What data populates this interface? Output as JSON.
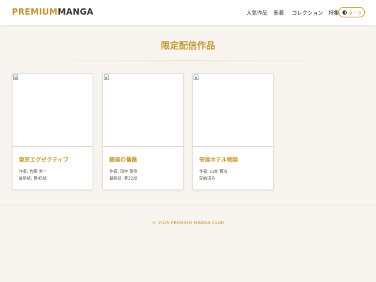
{
  "header": {
    "logo_part1": "PREMIUM",
    "logo_part2": "MANGA",
    "nav": [
      "人気作品",
      "新着",
      "コレクション",
      "特集"
    ],
    "theme_toggle_label": "ダーク"
  },
  "main": {
    "section_title": "限定配信作品",
    "works": [
      {
        "title": "東京エグゼクティブ",
        "author": "作者: 佐藤 栄一",
        "status": "最新話: 第45話"
      },
      {
        "title": "銀座の薔薇",
        "author": "作者: 田中 美咲",
        "status": "最新話: 第22話"
      },
      {
        "title": "帝国ホテル物語",
        "author": "作者: 山本 賢治",
        "status": "完結済み"
      }
    ]
  },
  "footer": {
    "copyright": "© 2025 PREMIUM MANGA CLUB"
  },
  "colors": {
    "accent": "#c9962b",
    "background": "#f8f4f0",
    "text": "#2e2a26"
  }
}
